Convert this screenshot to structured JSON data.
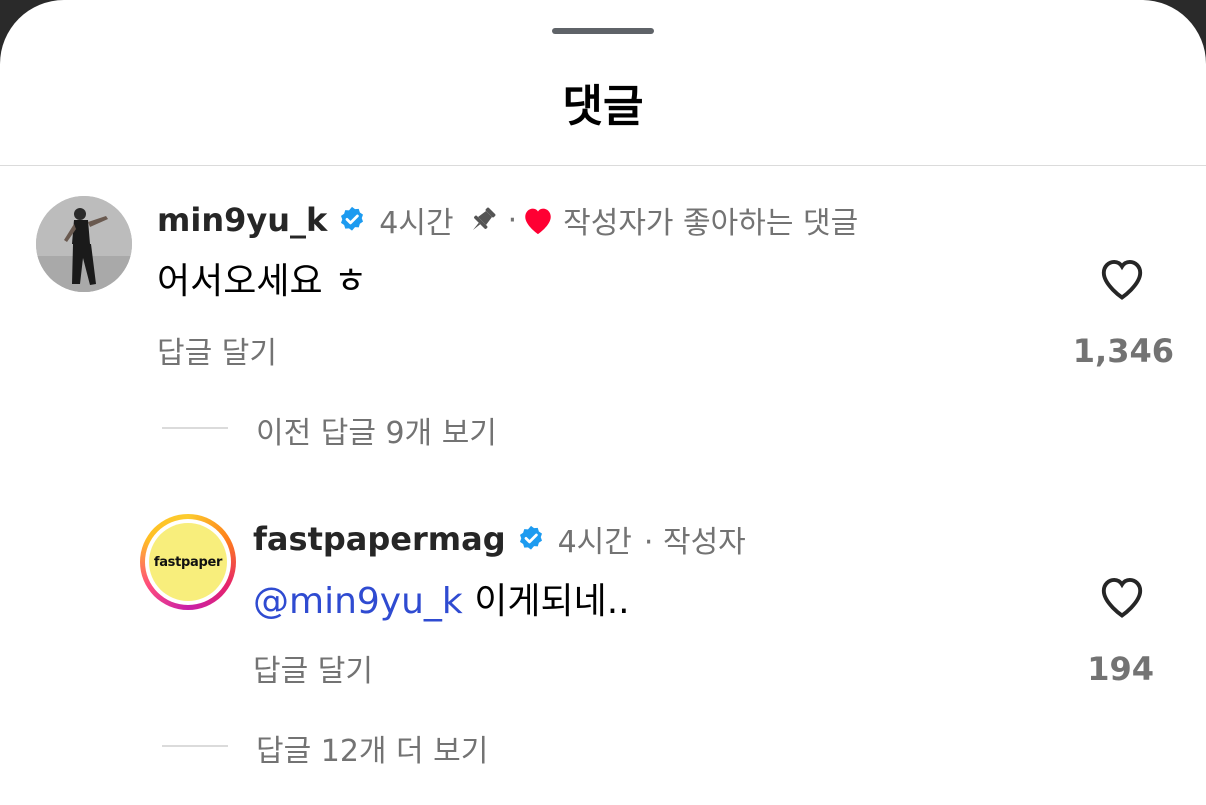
{
  "header": {
    "title": "댓글"
  },
  "comments": [
    {
      "username": "min9yu_k",
      "verified": true,
      "time": "4시간",
      "pinned": true,
      "separator": "·",
      "liked_by_author_text": "작성자가 좋아하는 댓글",
      "text": "어서오세요 ㅎ",
      "reply_label": "답글 달기",
      "like_count": "1,346",
      "view_replies": "이전 답글 9개 보기"
    },
    {
      "username": "fastpapermag",
      "verified": true,
      "avatar_text": "fastpaper",
      "time": "4시간",
      "meta_suffix": "· 작성자",
      "mention": "@min9yu_k",
      "text": "이게되네..",
      "reply_label": "답글 달기",
      "like_count": "194",
      "view_replies": "답글 12개 더 보기"
    }
  ],
  "colors": {
    "verified": "#1d9bf0",
    "mention": "#2f4bd1",
    "heart": "#ff0033",
    "muted": "#737373"
  },
  "icons": {
    "verified": "verified-badge-icon",
    "pin": "pin-icon",
    "heart_filled": "heart-filled-icon",
    "heart_outline": "heart-outline-icon"
  }
}
